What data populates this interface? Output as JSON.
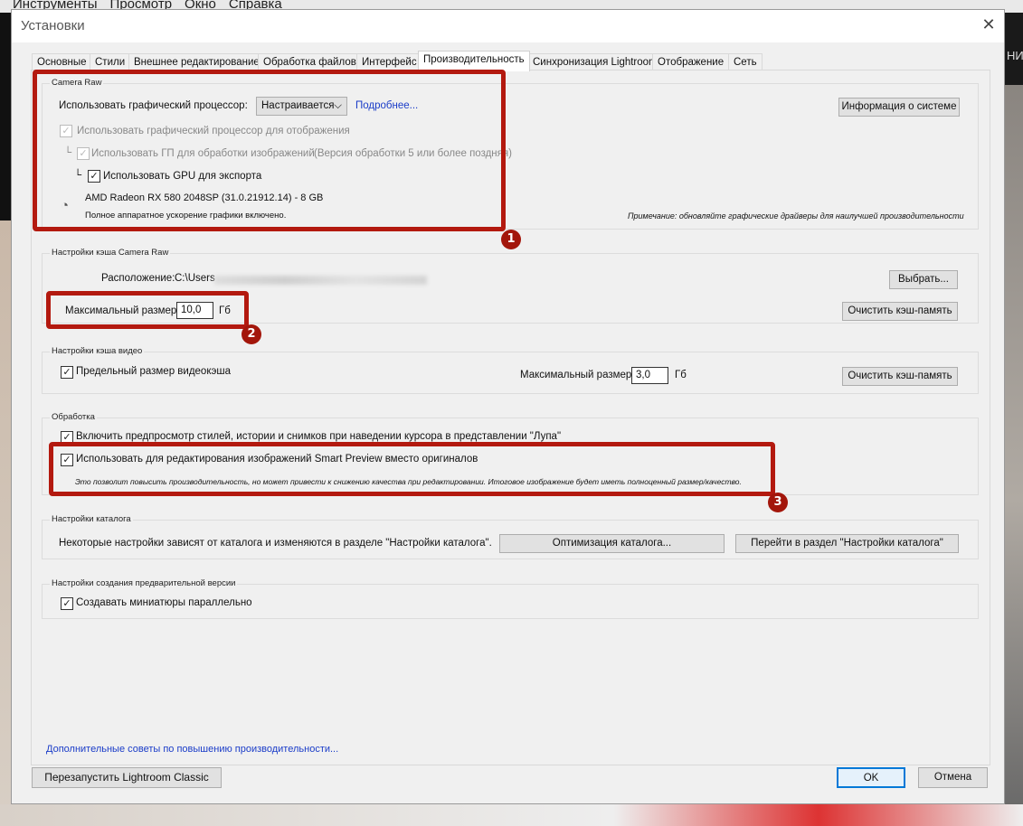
{
  "menubar": [
    "Инструменты",
    "Просмотр",
    "Окно",
    "Справка"
  ],
  "background_right_text": "НИ",
  "dialog": {
    "title": "Установки"
  },
  "tabs": [
    "Основные",
    "Стили",
    "Внешнее редактирование",
    "Обработка файлов",
    "Интерфейс",
    "Производительность",
    "Синхронизация Lightroom",
    "Отображение",
    "Сеть"
  ],
  "active_tab": "Производительность",
  "camera_raw": {
    "group_label": "Camera Raw",
    "gpu_label": "Использовать графический процессор:",
    "gpu_select": "Настраивается",
    "more_link": "Подробнее...",
    "system_info_button": "Информация о системе",
    "use_gpu_display": "Использовать графический процессор для отображения",
    "use_gpu_processing": "Использовать ГП для обработки изображений",
    "processing_note": "(Версия обработки 5 или более поздняя)",
    "use_gpu_export": "Использовать GPU для экспорта",
    "gpu_name": "AMD Radeon RX 580 2048SP (31.0.21912.14) - 8 GB",
    "gpu_status": "Полное аппаратное ускорение графики включено.",
    "driver_note": "Примечание: обновляйте графические драйверы для наилучшей производительности"
  },
  "cache": {
    "group_label": "Настройки кэша Camera Raw",
    "location_label": "Расположение:",
    "location_value": "C:\\Users",
    "choose_button": "Выбрать...",
    "max_size_label": "Максимальный размер:",
    "max_size_value": "10,0",
    "unit": "Гб",
    "clear_button": "Очистить кэш-память"
  },
  "video_cache": {
    "group_label": "Настройки кэша видео",
    "limit_label": "Предельный размер видеокэша",
    "max_size_label": "Максимальный размер:",
    "max_size_value": "3,0",
    "unit": "Гб",
    "clear_button": "Очистить кэш-память"
  },
  "processing": {
    "group_label": "Обработка",
    "preview_styles": "Включить предпросмотр стилей, истории и снимков при наведении курсора в представлении \"Лупа\"",
    "smart_preview": "Использовать для редактирования изображений Smart Preview вместо оригиналов",
    "smart_preview_note": "Это позволит повысить производительность, но может привести к снижению качества при редактировании. Итоговое изображение будет иметь полноценный размер/качество."
  },
  "catalog": {
    "group_label": "Настройки каталога",
    "text": "Некоторые настройки зависят от каталога и изменяются в разделе \"Настройки каталога\".",
    "optimize_button": "Оптимизация каталога...",
    "goto_button": "Перейти в раздел \"Настройки каталога\""
  },
  "preview": {
    "group_label": "Настройки создания предварительной версии",
    "parallel_thumbs": "Создавать миниатюры параллельно"
  },
  "tips_link": "Дополнительные советы по повышению производительности...",
  "footer": {
    "restart_button": "Перезапустить Lightroom Classic",
    "ok_button": "OK",
    "cancel_button": "Отмена"
  },
  "annotations": [
    "1",
    "2",
    "3"
  ],
  "colors": {
    "annotation": "#b3190f",
    "link": "#1a3cc8"
  }
}
